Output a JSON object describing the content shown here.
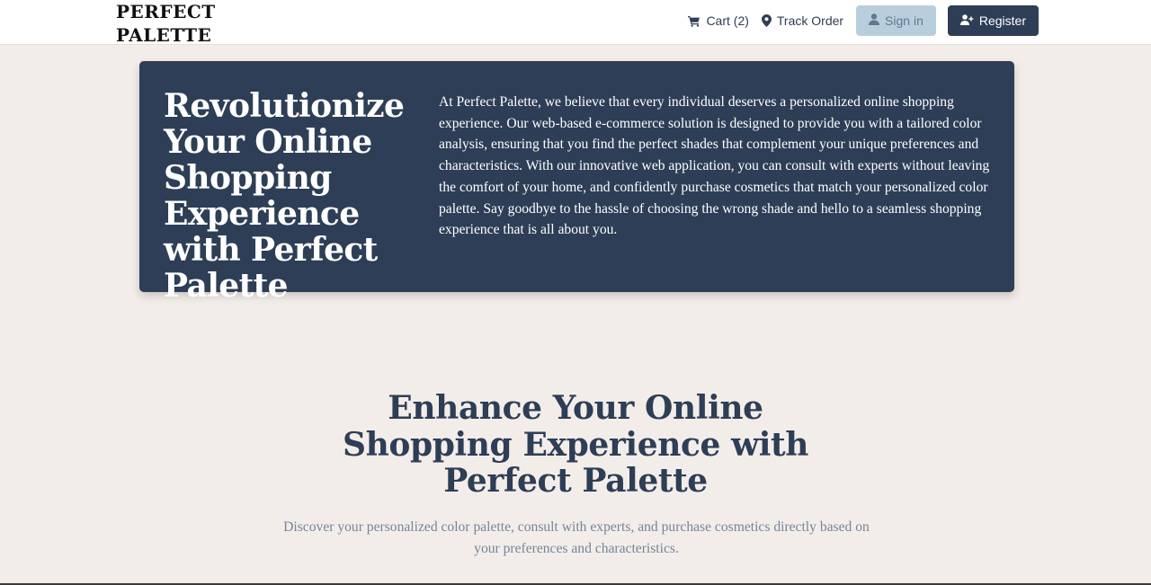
{
  "navbar": {
    "logo_line1": "PERFECT",
    "logo_line2": "PALETTE",
    "cart_label": "Cart (2)",
    "cart_icon": "shopping-cart-icon",
    "track_label": "Track Order",
    "track_icon": "map-marker-icon",
    "signin_label": "Sign in",
    "signin_icon": "user-icon",
    "register_label": "Register",
    "register_icon": "user-plus-icon"
  },
  "hero": {
    "title": "Revolutionize Your Online Shopping Experience with Perfect Palette",
    "description": "At Perfect Palette, we believe that every individual deserves a personalized online shopping experience. Our web-based e-commerce solution is designed to provide you with a tailored color analysis, ensuring that you find the perfect shades that complement your unique preferences and characteristics. With our innovative web application, you can consult with experts without leaving the comfort of your home, and confidently purchase cosmetics that match your personalized color palette. Say goodbye to the hassle of choosing the wrong shade and hello to a seamless shopping experience that is all about you."
  },
  "section": {
    "title": "Enhance Your Online Shopping Experience with Perfect Palette",
    "subtitle": "Discover your personalized color palette, consult with experts, and purchase cosmetics directly based on your preferences and characteristics."
  },
  "colors": {
    "brand_dark": "#2d3e56",
    "background": "#f3ede9",
    "signin_bg": "#b9cedd",
    "muted_text": "#738699"
  }
}
